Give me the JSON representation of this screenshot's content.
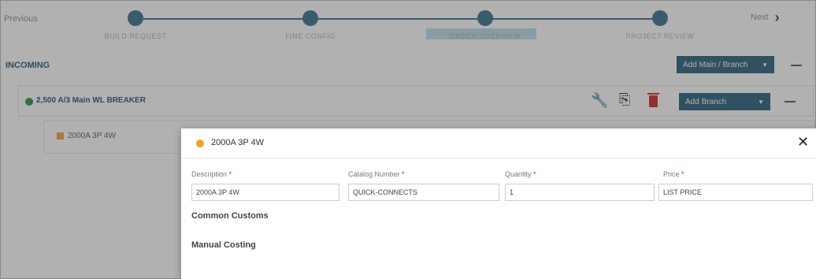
{
  "stepper": {
    "previous_label": "Previous",
    "next_label": "Next",
    "steps": [
      {
        "label": "BUILD REQUEST"
      },
      {
        "label": "FINE CONFIG"
      },
      {
        "label": "ORDER OVERVIEW"
      },
      {
        "label": "PROJECT REVIEW"
      }
    ]
  },
  "section": {
    "title": "INCOMING",
    "add_main_label": "Add Main / Branch"
  },
  "main_breaker": {
    "label": "2,500 A/3 Main WL BREAKER",
    "status_color": "#2e8b3e",
    "add_branch_label": "Add Branch"
  },
  "branch": {
    "label": "2000A 3P 4W",
    "status_color": "#f0a030"
  },
  "modal": {
    "title": "2000A 3P 4W",
    "status_color": "#f4a21e",
    "close_icon": "close-icon",
    "fields": {
      "description": {
        "label": "Description",
        "required": "*",
        "value": "2000A 3P 4W"
      },
      "catalog": {
        "label": "Catalog Number",
        "required": "*",
        "value": "QUICK-CONNECTS"
      },
      "quantity": {
        "label": "Quantity",
        "required": "*",
        "value": "1"
      },
      "price": {
        "label": "Price",
        "required": "*",
        "value": "LIST PRICE"
      }
    },
    "common_customs": "Common Customs",
    "manual_costing": "Manual Costing"
  },
  "colors": {
    "accent": "#1f5a78",
    "delete": "#d42020"
  }
}
